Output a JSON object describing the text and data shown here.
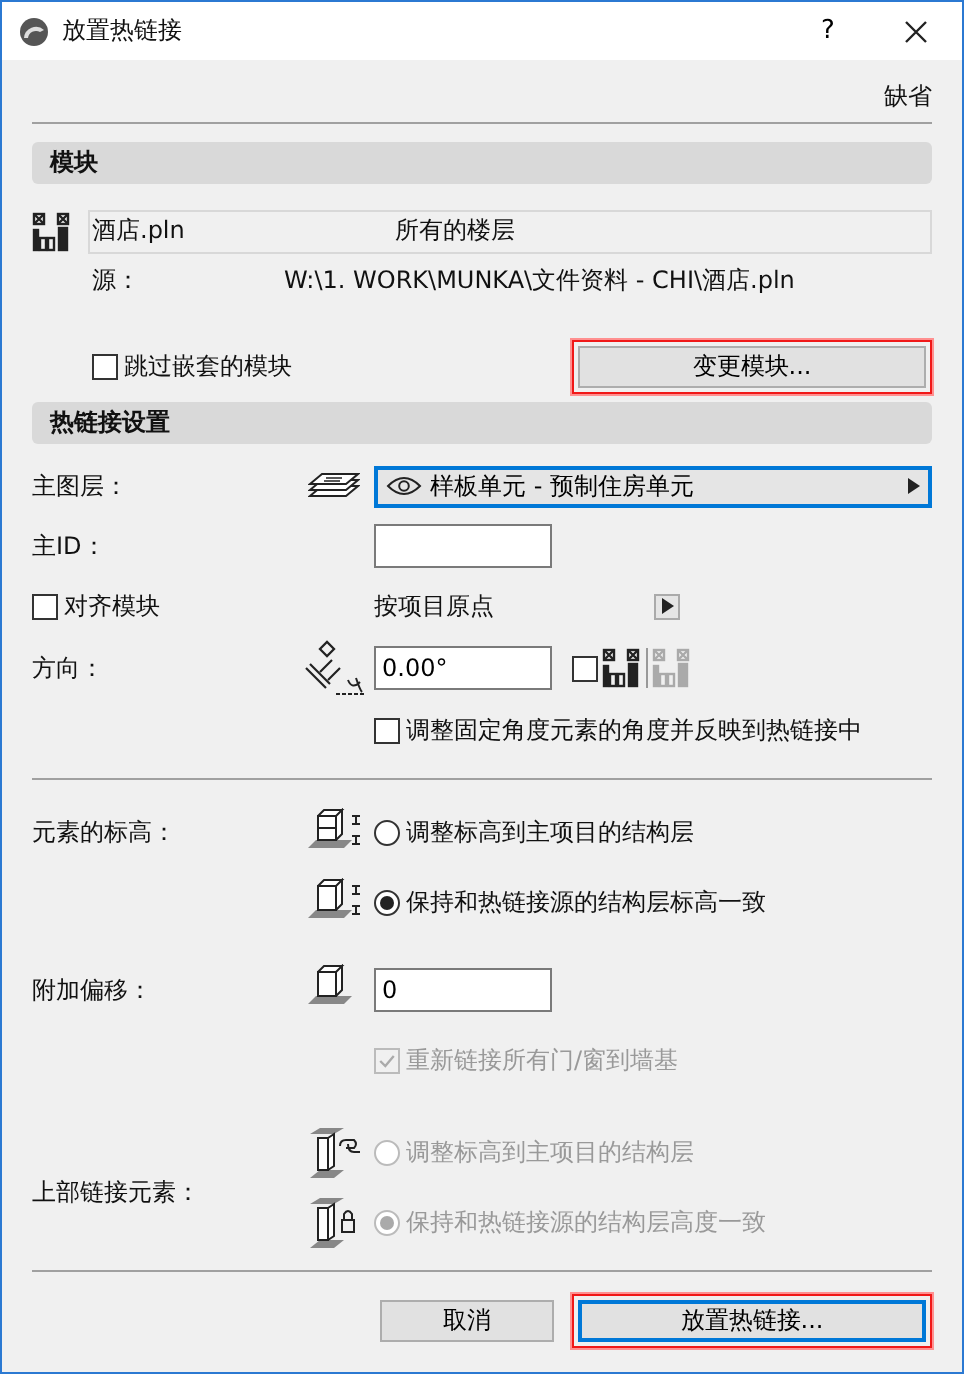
{
  "window": {
    "title": "放置热链接",
    "help": "?"
  },
  "defaults_link": "缺省",
  "module_section": {
    "title": "模块",
    "file": "酒店.pln",
    "stories": "所有的楼层",
    "source_label": "源：",
    "source_path": "W:\\1. WORK\\MUNKA\\文件资料 - CHI\\酒店.pln",
    "skip_nested": {
      "label": "跳过嵌套的模块",
      "checked": false
    },
    "change_button": {
      "label": "变更模块...",
      "highlighted": true
    }
  },
  "settings_section": {
    "title": "热链接设置",
    "master_layer": {
      "label": "主图层：",
      "value": "样板单元 - 预制住房单元"
    },
    "master_id": {
      "label": "主ID："
    },
    "align": {
      "label": "对齐模块",
      "checked": false,
      "option": "按项目原点"
    },
    "orientation": {
      "label": "方向：",
      "value": "0.00°",
      "mirror_checked": false
    },
    "adjust_angle": {
      "label": "调整固定角度元素的角度并反映到热链接中",
      "checked": false
    }
  },
  "elevation": {
    "label": "元素的标高：",
    "options": [
      {
        "label": "调整标高到主项目的结构层",
        "selected": false
      },
      {
        "label": "保持和热链接源的结构层标高一致",
        "selected": true
      }
    ]
  },
  "offset": {
    "label": "附加偏移：",
    "value": "0",
    "relink": {
      "label": "重新链接所有门/窗到墙基",
      "checked": true,
      "disabled": true
    }
  },
  "top_linked": {
    "label": "上部链接元素：",
    "disabled": true,
    "options": [
      {
        "label": "调整标高到主项目的结构层",
        "selected": false
      },
      {
        "label": "保持和热链接源的结构层高度一致",
        "selected": true
      }
    ]
  },
  "buttons": [
    {
      "label": "取消",
      "kind": "cancel",
      "highlighted": false
    },
    {
      "label": "放置热链接...",
      "kind": "default",
      "highlighted": true
    }
  ]
}
